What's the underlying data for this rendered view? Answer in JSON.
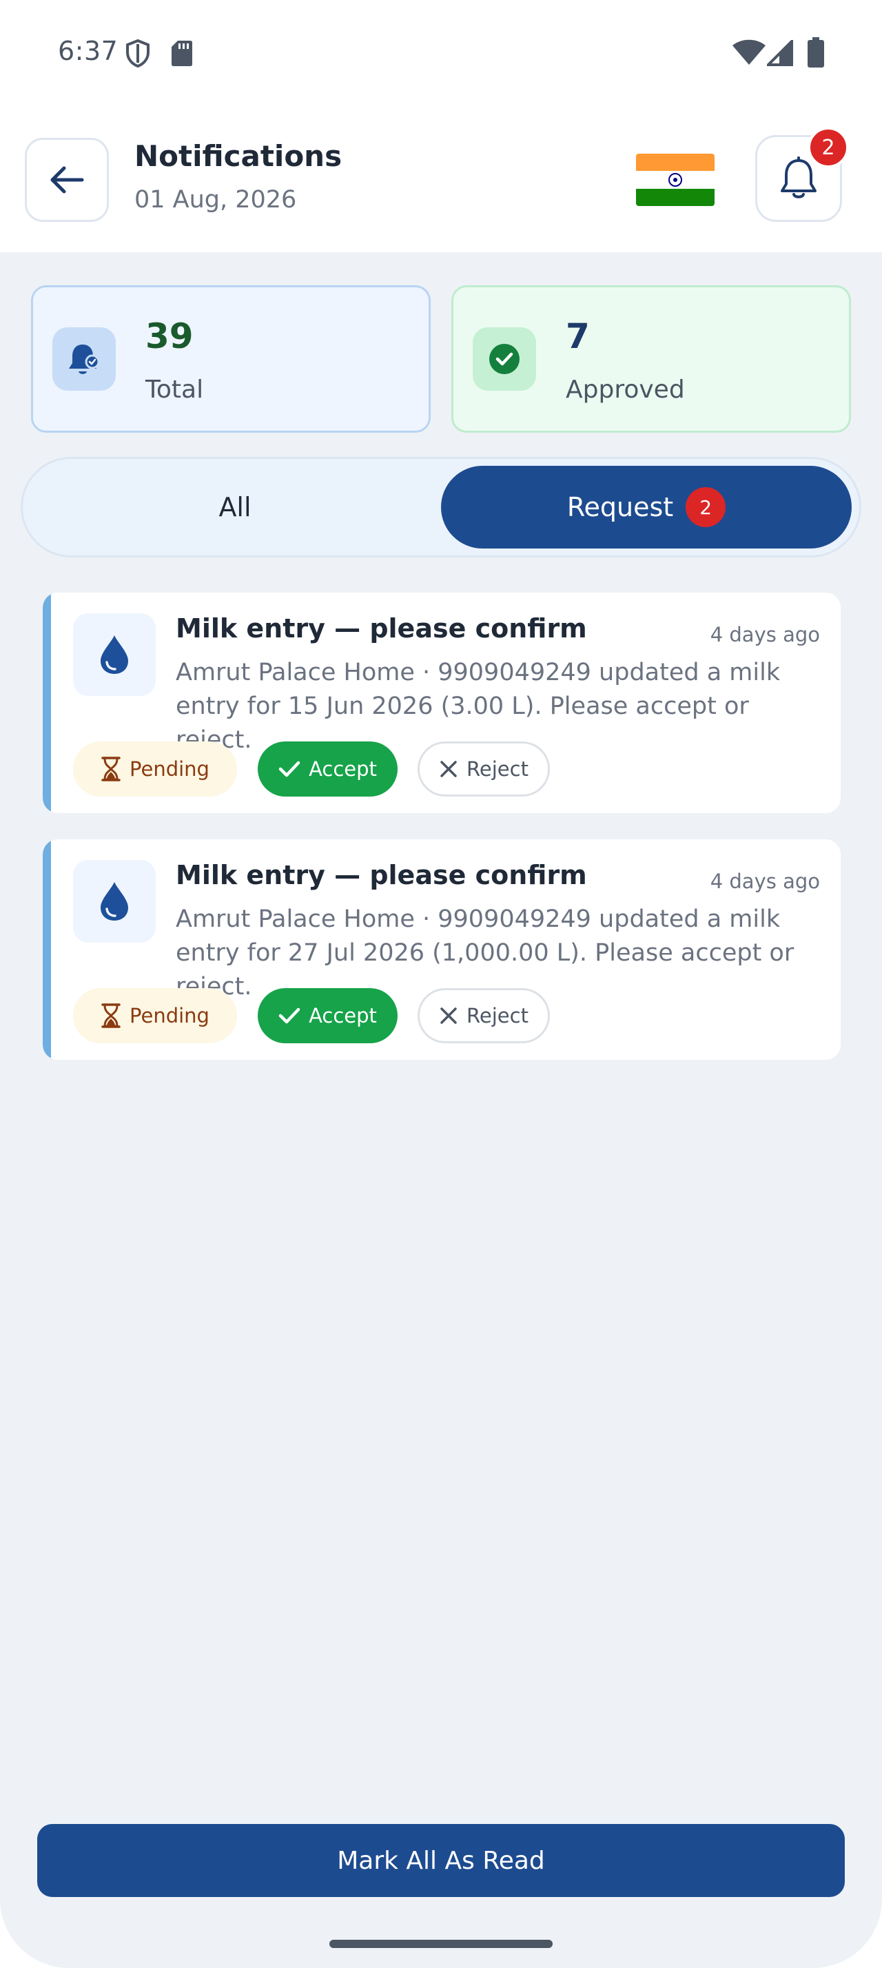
{
  "status_bar": {
    "time": "6:37",
    "icons": [
      "shield-icon",
      "sd-card-icon",
      "wifi-icon",
      "cell-signal-icon",
      "battery-icon"
    ]
  },
  "header": {
    "title": "Notifications",
    "date": "01 Aug, 2026",
    "bell_badge": "2",
    "flag": "india-flag"
  },
  "stats": {
    "total": {
      "value": "39",
      "label": "Total"
    },
    "approved": {
      "value": "7",
      "label": "Approved"
    }
  },
  "tabs": {
    "all_label": "All",
    "request_label": "Request",
    "request_badge": "2",
    "active": "Request"
  },
  "notifications": [
    {
      "title": "Milk entry — please confirm",
      "time": "4 days ago",
      "body": "Amrut Palace Home · 9909049249 updated a milk entry for 15 Jun 2026 (3.00 L). Please accept or reject.",
      "status": "Pending",
      "accept_label": "Accept",
      "reject_label": "Reject"
    },
    {
      "title": "Milk entry — please confirm",
      "time": "4 days ago",
      "body": "Amrut Palace Home · 9909049249 updated a milk entry for 27 Jul 2026 (1,000.00 L). Please accept or reject.",
      "status": "Pending",
      "accept_label": "Accept",
      "reject_label": "Reject"
    }
  ],
  "footer": {
    "mark_all_label": "Mark All As Read"
  },
  "colors": {
    "primary": "#1d4b8f",
    "accept": "#16a34a",
    "badge": "#dc2626",
    "pending_bg": "#fdf7e3",
    "card_accent": "#6faee0"
  }
}
